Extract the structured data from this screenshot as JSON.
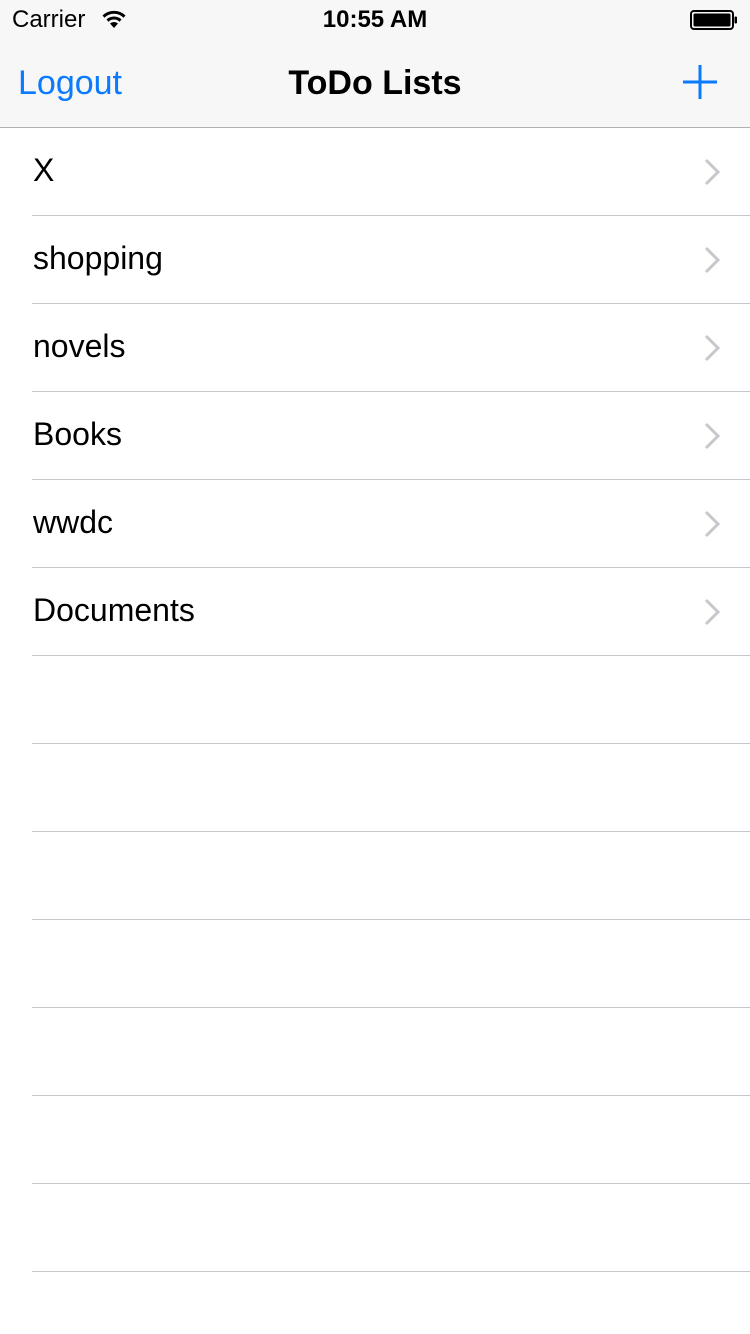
{
  "status_bar": {
    "carrier": "Carrier",
    "time": "10:55 AM",
    "wifi_icon": "wifi-icon",
    "battery_icon": "battery-icon"
  },
  "nav_bar": {
    "left_button": "Logout",
    "title": "ToDo Lists",
    "right_icon": "plus-icon"
  },
  "colors": {
    "tint": "#0a7aff",
    "separator": "#c8c7cc",
    "chevron": "#c7c7cc",
    "bar_background": "#f7f7f7"
  },
  "lists": [
    {
      "label": "X"
    },
    {
      "label": "shopping"
    },
    {
      "label": "novels"
    },
    {
      "label": "Books"
    },
    {
      "label": "wwdc"
    },
    {
      "label": "Documents"
    }
  ]
}
